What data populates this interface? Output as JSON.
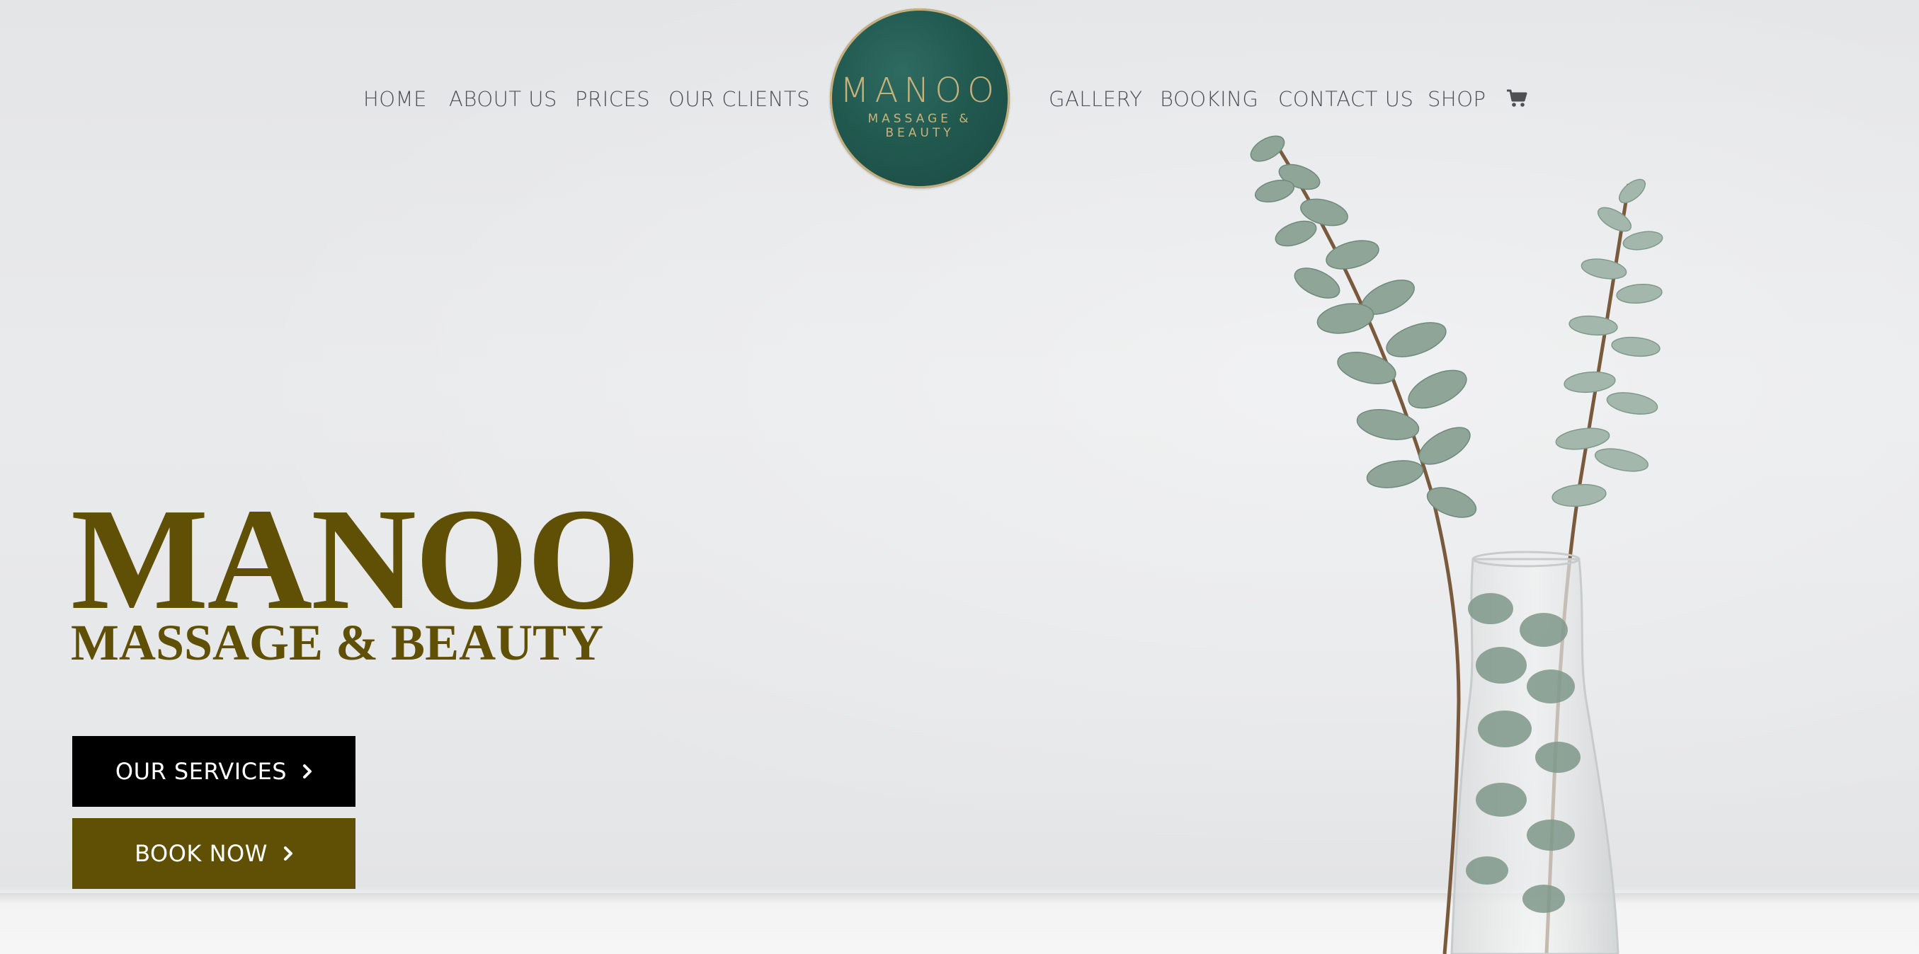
{
  "nav": {
    "left": [
      "HOME",
      "ABOUT US",
      "PRICES",
      "OUR CLIENTS"
    ],
    "right": [
      "GALLERY",
      "BOOKING",
      "CONTACT US",
      "SHOP"
    ],
    "cart_icon": "shopping-cart-icon"
  },
  "logo": {
    "name": "MANOO",
    "tagline": "MASSAGE & BEAUTY"
  },
  "hero": {
    "title": "MANOO",
    "subtitle": "MASSAGE & BEAUTY",
    "services_button": "OUR SERVICES",
    "book_button": "BOOK NOW",
    "button_icon": "chevron-right-icon"
  },
  "colors": {
    "brand_olive": "#5f5005",
    "logo_green": "#21594f",
    "logo_gold": "#c9b27a",
    "nav_text": "#4e5054",
    "button_dark": "#000000"
  }
}
